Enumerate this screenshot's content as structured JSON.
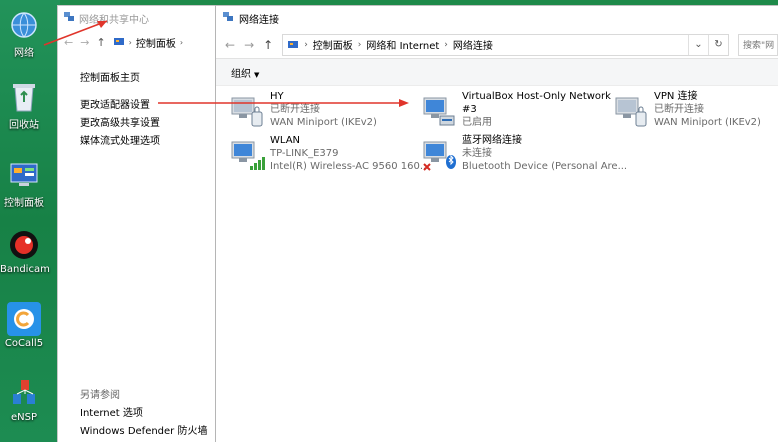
{
  "desktop": {
    "icons": [
      {
        "label": "网络",
        "icon": "network-icon"
      },
      {
        "label": "回收站",
        "icon": "recycle-bin-icon"
      },
      {
        "label": "控制面板",
        "icon": "control-panel-icon"
      },
      {
        "label": "Bandicam",
        "icon": "bandicam-icon"
      },
      {
        "label": "CoCall5",
        "icon": "cocall-icon"
      },
      {
        "label": "eNSP",
        "icon": "ensp-icon"
      }
    ]
  },
  "back_window": {
    "title": "网络和共享中心",
    "crumb": "控制面板",
    "sidebar": {
      "home": "控制面板主页",
      "links": [
        "更改适配器设置",
        "更改高级共享设置",
        "媒体流式处理选项"
      ],
      "see_also_title": "另请参阅",
      "see_also": [
        "Internet 选项",
        "Windows Defender 防火墙"
      ]
    }
  },
  "front_window": {
    "title": "网络连接",
    "breadcrumb": [
      "控制面板",
      "网络和 Internet",
      "网络连接"
    ],
    "search_placeholder": "搜索\"网",
    "organize": "组织",
    "connections": [
      {
        "name": "HY",
        "status": "已断开连接",
        "device": "WAN Miniport (IKEv2)",
        "icon": "vpn-adapter-icon"
      },
      {
        "name": "VirtualBox Host-Only Network",
        "name2": "#3",
        "status": "已启用",
        "device": "",
        "icon": "ethernet-adapter-icon"
      },
      {
        "name": "VPN 连接",
        "status": "已断开连接",
        "device": "WAN Miniport (IKEv2)",
        "icon": "vpn-adapter-icon"
      },
      {
        "name": "WLAN",
        "status": "TP-LINK_E379",
        "device": "Intel(R) Wireless-AC 9560 160...",
        "icon": "wlan-adapter-icon"
      },
      {
        "name": "蓝牙网络连接",
        "status": "未连接",
        "device": "Bluetooth Device (Personal Are...",
        "icon": "bluetooth-adapter-icon"
      }
    ]
  },
  "colors": {
    "arrow": "#e0352b",
    "desktop": "#1e8a4a",
    "link": "#000000"
  }
}
